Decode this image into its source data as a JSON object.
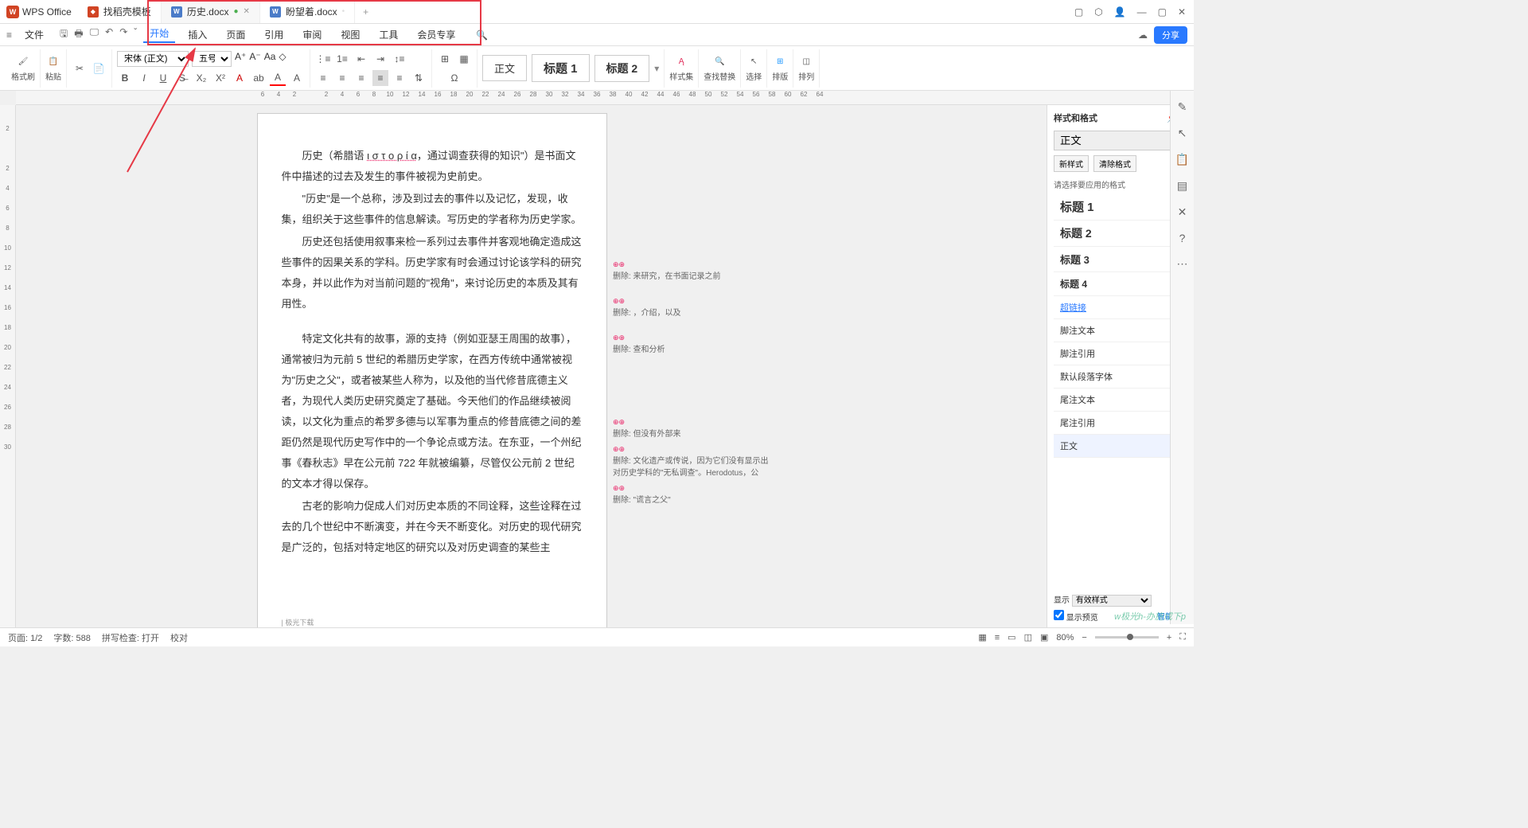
{
  "app": {
    "name": "WPS Office"
  },
  "tabs": {
    "template": "找稻壳模板",
    "doc1": "历史.docx",
    "doc2": "盼望着.docx"
  },
  "menu": {
    "file": "文件",
    "start": "开始",
    "insert": "插入",
    "page": "页面",
    "ref": "引用",
    "review": "审阅",
    "view": "视图",
    "tools": "工具",
    "vip": "会员专享"
  },
  "share": "分享",
  "ribbon": {
    "format_brush": "格式刷",
    "paste": "粘贴",
    "font_name": "宋体 (正文)",
    "font_size": "五号",
    "body": "正文",
    "heading1": "标题 1",
    "heading2": "标题 2",
    "styles": "样式集",
    "find": "查找替换",
    "select": "选择",
    "layout": "排版",
    "arrange": "排列"
  },
  "ruler_nums": [
    "6",
    "4",
    "2",
    "",
    "2",
    "4",
    "6",
    "8",
    "10",
    "12",
    "14",
    "16",
    "18",
    "20",
    "22",
    "24",
    "26",
    "28",
    "30",
    "32",
    "34",
    "36",
    "38",
    "40",
    "42",
    "44",
    "46",
    "48",
    "50",
    "52",
    "54",
    "56",
    "58",
    "60",
    "62",
    "64"
  ],
  "vruler_nums": [
    "",
    "2",
    "",
    "2",
    "4",
    "6",
    "8",
    "10",
    "12",
    "14",
    "16",
    "18",
    "20",
    "22",
    "24",
    "26",
    "28",
    "30"
  ],
  "doc": {
    "p1a": "历史（希腊语 ",
    "p1b": "ι σ τ ο ρ ί α",
    "p1c": "，通过调查获得的知识\"）是书面文件中描述的过去及发生的事件被视为史前史。",
    "p2": "\"历史\"是一个总称，涉及到过去的事件以及记忆，发现，收集，组织关于这些事件的信息解读。写历史的学者称为历史学家。",
    "p3": "历史还包括使用叙事来检一系列过去事件并客观地确定造成这些事件的因果关系的学科。历史学家有时会通过讨论该学科的研究本身，并以此作为对当前问题的\"视角\"，来讨论历史的本质及其有用性。",
    "p4": "特定文化共有的故事，源的支持（例如亚瑟王周围的故事），通常被归为元前 5 世纪的希腊历史学家，在西方传统中通常被视为\"历史之父\"，或者被某些人称为，以及他的当代修昔底德主义者，为现代人类历史研究奠定了基础。今天他们的作品继续被阅读，以文化为重点的希罗多德与以军事为重点的修昔底德之间的差距仍然是现代历史写作中的一个争论点或方法。在东亚，一个州纪事《春秋志》早在公元前 722 年就被编纂，尽管仅公元前 2 世纪的文本才得以保存。",
    "p5": "古老的影响力促成人们对历史本质的不同诠释，这些诠释在过去的几个世纪中不断演变，并在今天不断变化。对历史的现代研究是广泛的，包括对特定地区的研究以及对历史调查的某些主",
    "footer": "| 极光下载"
  },
  "comments": {
    "c1": "删除: 来研究，在书面记录之前",
    "c2": "删除: ，介绍，以及",
    "c3": "删除: 查和分析",
    "c4": "删除: 但没有外部来",
    "c5": "删除: 文化遗产或传说，因为它们没有显示出对历史学科的\"无私调查\"。Herodotus，公",
    "c6": "删除: \"谎言之父\""
  },
  "panel": {
    "title": "样式和格式",
    "current": "正文",
    "new_style": "新样式",
    "clear": "清除格式",
    "prompt": "请选择要应用的格式",
    "items": {
      "h1": "标题 1",
      "h2": "标题 2",
      "h3": "标题 3",
      "h4": "标题 4",
      "link": "超链接",
      "footnote": "脚注文本",
      "footref": "脚注引用",
      "default_font": "默认段落字体",
      "endnote": "尾注文本",
      "endref": "尾注引用",
      "body": "正文"
    },
    "show": "显示",
    "show_val": "有效样式",
    "preview": "显示预览",
    "smart": "智能排版"
  },
  "status": {
    "page": "页面: 1/2",
    "words": "字数: 588",
    "spell": "拼写检查: 打开",
    "proof": "校对",
    "zoom": "80%"
  },
  "watermark": "w极光h-办施成下p"
}
